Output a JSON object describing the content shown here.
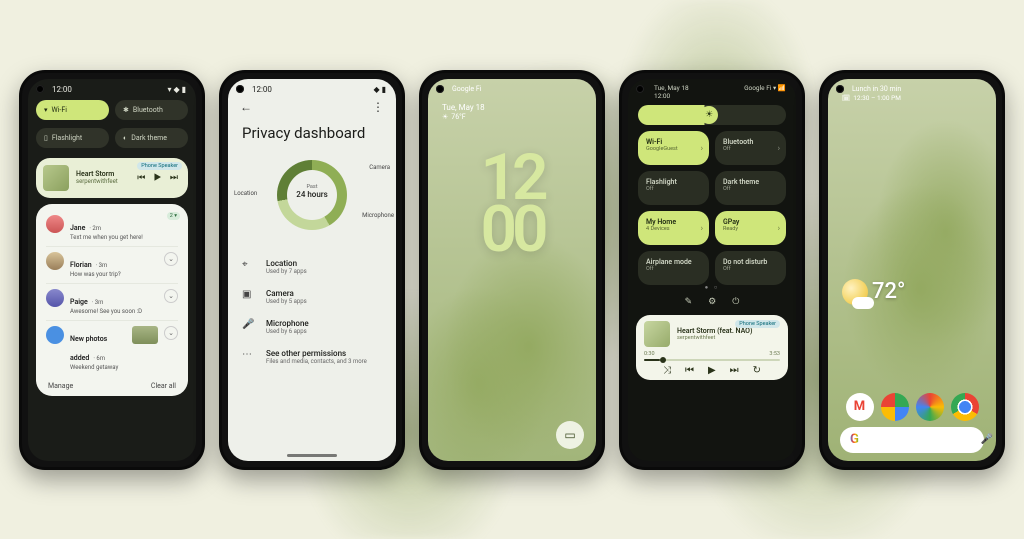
{
  "colors": {
    "accent": "#cfe67a",
    "dark": "#1a1c18",
    "light": "#eef0ea"
  },
  "phone1": {
    "status_time": "12:00",
    "qs": {
      "wifi": "Wi-Fi",
      "bluetooth": "Bluetooth",
      "flashlight": "Flashlight",
      "dark_theme": "Dark theme"
    },
    "media": {
      "title": "Heart Storm",
      "artist": "serpentwithfeet",
      "badge": "Phone Speaker"
    },
    "notifs": {
      "n1_name": "Jane",
      "n1_time": "· 2m",
      "n1_body": "Text me when you get here!",
      "n2_name": "Florian",
      "n2_time": "· 3m",
      "n2_body": "How was your trip?",
      "n3_name": "Paige",
      "n3_time": "· 3m",
      "n3_body": "Awesome! See you soon :D",
      "n4_title": "New photos added",
      "n4_time": "· 6m",
      "n4_sub": "Weekend getaway",
      "reply_chip": "2 ▾"
    },
    "footer": {
      "manage": "Manage",
      "clear": "Clear all"
    }
  },
  "phone2": {
    "status_time": "12:00",
    "title": "Privacy dashboard",
    "donut": {
      "caption": "Past",
      "value": "24 hours",
      "l_loc": "Location",
      "l_cam": "Camera",
      "l_mic": "Microphone"
    },
    "items": {
      "loc_t": "Location",
      "loc_s": "Used by 7 apps",
      "cam_t": "Camera",
      "cam_s": "Used by 5 apps",
      "mic_t": "Microphone",
      "mic_s": "Used by 6 apps",
      "more_t": "See other permissions",
      "more_s": "Files and media, contacts, and 3 more"
    }
  },
  "phone3": {
    "carrier": "Google Fi",
    "date": "Tue, May 18",
    "temp": "76°F",
    "clock_top": "12",
    "clock_bot": "00"
  },
  "phone4": {
    "date_line": "Tue, May 18",
    "time_line": "12:00",
    "carrier_line": "Google Fi",
    "tiles": {
      "wifi_t": "Wi-Fi",
      "wifi_s": "GoogleGuest",
      "bt_t": "Bluetooth",
      "bt_s": "Off",
      "flash_t": "Flashlight",
      "flash_s": "Off",
      "dark_t": "Dark theme",
      "dark_s": "Off",
      "home_t": "My Home",
      "home_s": "4 Devices",
      "gpay_t": "GPay",
      "gpay_s": "Ready",
      "air_t": "Airplane mode",
      "air_s": "Off",
      "dnd_t": "Do not disturb",
      "dnd_s": "Off"
    },
    "media": {
      "badge": "Phone Speaker",
      "title": "Heart Storm (feat. NAO)",
      "artist": "serpentwithfeet",
      "elapsed": "0:30",
      "total": "3:53"
    }
  },
  "phone5": {
    "event_title": "Lunch in 30 min",
    "event_sub": "12:30 – 1:00 PM",
    "temp": "72°",
    "search_placeholder": ""
  }
}
